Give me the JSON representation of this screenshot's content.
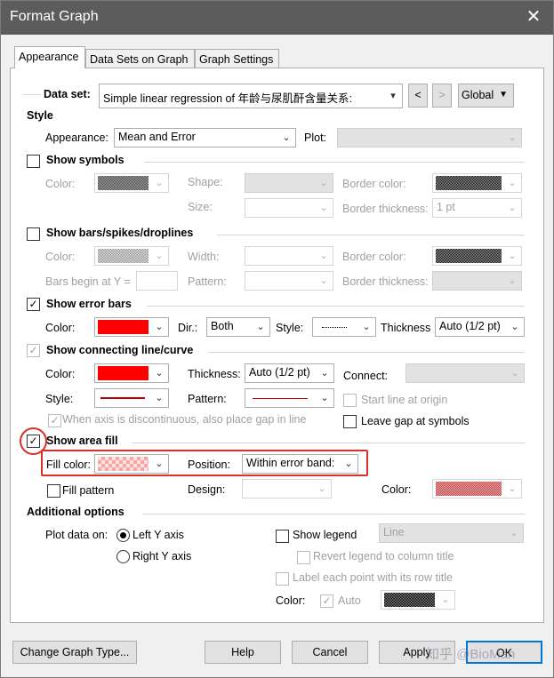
{
  "window": {
    "title": "Format Graph",
    "close": "✕"
  },
  "tabs": [
    "Appearance",
    "Data Sets on Graph",
    "Graph Settings"
  ],
  "dataset": {
    "label": "Data set:",
    "value": "Simple linear regression of 年龄与尿肌酐含量关系:",
    "prev": "<",
    "next": ">",
    "scope": "Global"
  },
  "style": {
    "heading": "Style",
    "appearance_label": "Appearance:",
    "appearance_value": "Mean and Error",
    "plot_label": "Plot:"
  },
  "symbols": {
    "heading": "Show symbols",
    "color": "Color:",
    "shape": "Shape:",
    "size": "Size:",
    "border_color": "Border color:",
    "border_thickness": "Border thickness:",
    "border_thickness_value": "1 pt"
  },
  "bars": {
    "heading": "Show bars/spikes/droplines",
    "color": "Color:",
    "width": "Width:",
    "border_color": "Border color:",
    "begin": "Bars begin at Y =",
    "pattern": "Pattern:",
    "border_thickness": "Border thickness:"
  },
  "error": {
    "heading": "Show error bars",
    "color": "Color:",
    "dir": "Dir.:",
    "dir_value": "Both",
    "style": "Style:",
    "thickness": "Thickness",
    "thickness_value": "Auto (1/2 pt)",
    "color_hex": "#ff0000"
  },
  "line": {
    "heading": "Show connecting line/curve",
    "color": "Color:",
    "thickness": "Thickness:",
    "thickness_value": "Auto (1/2 pt)",
    "connect": "Connect:",
    "style": "Style:",
    "pattern": "Pattern:",
    "start_origin": "Start line at origin",
    "gap_text": "When axis is discontinuous, also place gap in line",
    "leave_gap": "Leave gap at symbols",
    "color_hex": "#ff0000"
  },
  "area": {
    "heading": "Show area fill",
    "fill_color": "Fill color:",
    "position": "Position:",
    "position_value": "Within error band:",
    "fill_pattern": "Fill pattern",
    "design": "Design:",
    "color": "Color:"
  },
  "additional": {
    "heading": "Additional options",
    "plot_on": "Plot data on:",
    "left_axis": "Left Y axis",
    "right_axis": "Right  Y axis",
    "show_legend": "Show legend",
    "legend_value": "Line",
    "revert": "Revert legend to column title",
    "label_point": "Label each point with its row title",
    "color": "Color:",
    "auto": "Auto"
  },
  "buttons": {
    "change": "Change Graph Type...",
    "help": "Help",
    "cancel": "Cancel",
    "apply": "Apply",
    "ok": "OK"
  },
  "watermark": "知乎 @BioMan"
}
